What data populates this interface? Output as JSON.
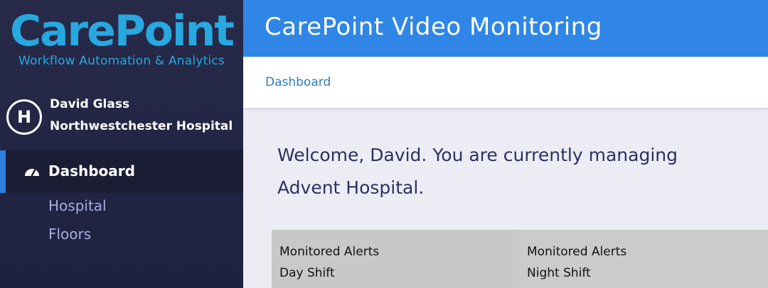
{
  "brand": {
    "name": "CarePoint",
    "tagline": "Workflow Automation & Analytics"
  },
  "user": {
    "logo_letter": "H",
    "name": "David Glass",
    "hospital": "Northwestchester Hospital"
  },
  "nav": {
    "active": {
      "label": "Dashboard",
      "icon": "speedometer-icon"
    },
    "items": [
      {
        "label": "Hospital"
      },
      {
        "label": "Floors"
      }
    ]
  },
  "header": {
    "title": "CarePoint Video Monitoring"
  },
  "breadcrumb": {
    "current": "Dashboard"
  },
  "main": {
    "welcome_line1": "Welcome, David. You are currently managing",
    "welcome_line2": "Advent Hospital."
  },
  "cards": [
    {
      "line1": "Monitored Alerts",
      "line2": "Day Shift"
    },
    {
      "line1": "Monitored Alerts",
      "line2": "Night Shift"
    }
  ],
  "colors": {
    "brand": "#27a8e0",
    "header": "#2f86e6",
    "sidebar": "#232644",
    "active_indicator": "#2d7fe0",
    "breadcrumb_link": "#2c7cc2"
  }
}
